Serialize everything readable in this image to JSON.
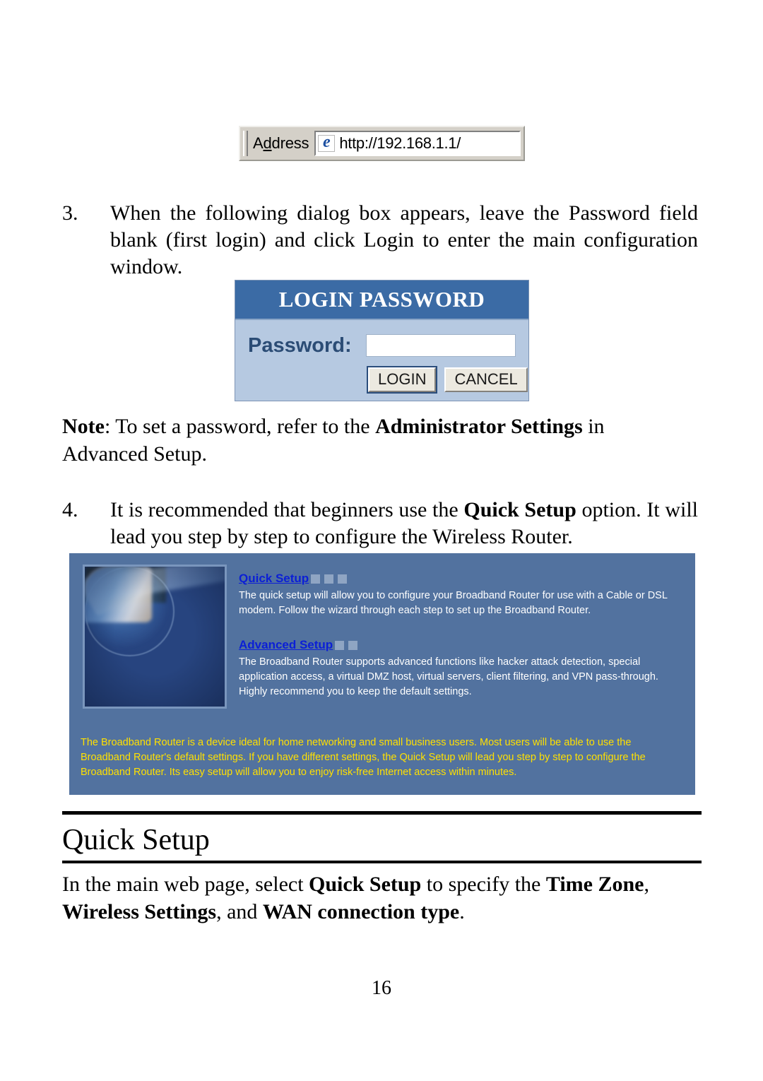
{
  "browser_address_bar": {
    "label": "Address",
    "label_accel": "d",
    "icon": "internet-explorer-icon",
    "url": "http://192.168.1.1/"
  },
  "steps": [
    {
      "number": "3.",
      "text": "When the following dialog box appears, leave the Password field blank (first login) and click Login to enter the main configuration window."
    },
    {
      "number": "4.",
      "text_before": "It is recommended that beginners use the ",
      "bold": "Quick Setup",
      "text_after": " option. It will lead you step by step to configure the Wireless Router."
    }
  ],
  "note": {
    "label": "Note",
    "text_before": ": To set a password, refer to the ",
    "bold": "Administrator Settings",
    "text_after": " in",
    "second_line": "Advanced Setup."
  },
  "login_dialog": {
    "title": "LOGIN PASSWORD",
    "password_label": "Password:",
    "password_value": "",
    "password_placeholder": "",
    "login_button": "LOGIN",
    "cancel_button": "CANCEL",
    "header_color": "#3b6ba5",
    "body_color": "#b6c9e1"
  },
  "router_ui": {
    "background_color": "#52729f",
    "link_color": "#0b1fd6",
    "footer_text_color": "#ffe000",
    "square_color": "#8fa5c3",
    "blocks": [
      {
        "link": "Quick Setup",
        "squares": 3,
        "description": "The quick setup will allow you to configure your Broadband Router for use with a Cable or DSL modem. Follow the wizard through each step to set up the Broadband Router."
      },
      {
        "link": "Advanced Setup",
        "squares": 2,
        "description": "The Broadband Router supports advanced functions like hacker attack detection, special application access, a virtual DMZ host, virtual servers, client filtering, and VPN pass-through. Highly recommend you to keep the default settings."
      }
    ],
    "footer": "The Broadband Router is a device ideal for home networking and small business users. Most users will be able to use the Broadband Router's default settings. If you have different settings, the Quick Setup will lead you step by step to configure the Broadband Router. Its easy setup will allow you to enjoy risk-free Internet access within minutes."
  },
  "section": {
    "heading": "Quick Setup",
    "paragraph": {
      "part1": "In the main web page, select ",
      "bold1": "Quick Setup",
      "part2": " to specify the ",
      "bold2": "Time Zone",
      "part3": ",",
      "bold3": "Wireless Settings",
      "part4": ", and ",
      "bold4": "WAN connection type",
      "part5": "."
    }
  },
  "page_number": "16"
}
